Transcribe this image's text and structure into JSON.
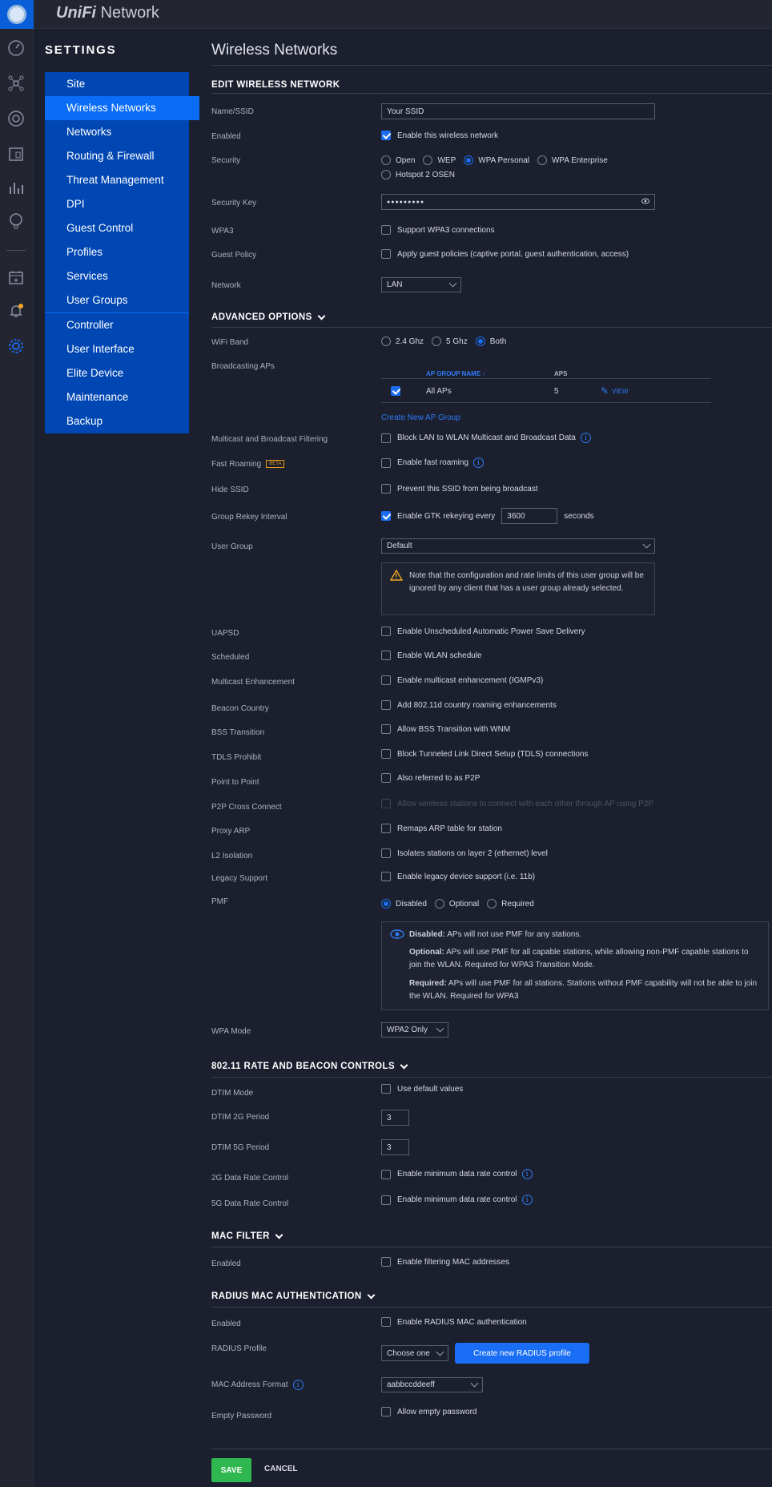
{
  "app": {
    "brand_prefix": "UniFi",
    "brand_suffix": "Network"
  },
  "settings_title": "SETTINGS",
  "nav": {
    "items": [
      "Site",
      "Wireless Networks",
      "Networks",
      "Routing & Firewall",
      "Threat Management",
      "DPI",
      "Guest Control",
      "Profiles",
      "Services",
      "User Groups"
    ],
    "items2": [
      "Controller",
      "User Interface",
      "Elite Device",
      "Maintenance",
      "Backup"
    ]
  },
  "page_title": "Wireless Networks",
  "edit": {
    "heading": "EDIT WIRELESS NETWORK",
    "name_label": "Name/SSID",
    "name_value": "Your SSID",
    "enabled_label": "Enabled",
    "enabled_text": "Enable this wireless network",
    "security_label": "Security",
    "security_options": [
      "Open",
      "WEP",
      "WPA Personal",
      "WPA Enterprise",
      "Hotspot 2 OSEN"
    ],
    "key_label": "Security Key",
    "key_value": "●●●●●●●●●",
    "wpa3_label": "WPA3",
    "wpa3_text": "Support WPA3 connections",
    "guest_label": "Guest Policy",
    "guest_text": "Apply guest policies (captive portal, guest authentication, access)",
    "network_label": "Network",
    "network_value": "LAN"
  },
  "advanced": {
    "heading": "ADVANCED OPTIONS",
    "band_label": "WiFi Band",
    "band_options": [
      "2.4 Ghz",
      "5 Ghz",
      "Both"
    ],
    "aps_label": "Broadcasting APs",
    "ap_table": {
      "col_name": "AP GROUP NAME",
      "col_aps": "APS",
      "row_name": "All APs",
      "row_aps": "5",
      "row_action": "VIEW"
    },
    "create_group": "Create New AP Group",
    "mcast_label": "Multicast and Broadcast Filtering",
    "mcast_text": "Block LAN to WLAN Multicast and Broadcast Data",
    "fast_label": "Fast Roaming",
    "beta": "BETA",
    "fast_text": "Enable fast roaming",
    "hide_label": "Hide SSID",
    "hide_text": "Prevent this SSID from being broadcast",
    "rekey_label": "Group Rekey Interval",
    "rekey_text": "Enable GTK rekeying every",
    "rekey_value": "3600",
    "rekey_unit": "seconds",
    "usergroup_label": "User Group",
    "usergroup_value": "Default",
    "warning": "Note that the configuration and rate limits of this user group will be ignored by any client that has a user group already selected.",
    "uapsd_label": "UAPSD",
    "uapsd_text": "Enable Unscheduled Automatic Power Save Delivery",
    "sched_label": "Scheduled",
    "sched_text": "Enable WLAN schedule",
    "menh_label": "Multicast Enhancement",
    "menh_text": "Enable multicast enhancement (IGMPv3)",
    "beacon_label": "Beacon Country",
    "beacon_text": "Add 802.11d country roaming enhancements",
    "bss_label": "BSS Transition",
    "bss_text": "Allow BSS Transition with WNM",
    "tdls_label": "TDLS Prohibit",
    "tdls_text": "Block Tunneled Link Direct Setup (TDLS) connections",
    "p2p_label": "Point to Point",
    "p2p_text": "Also referred to as P2P",
    "p2pc_label": "P2P Cross Connect",
    "p2pc_text": "Allow wireless stations to connect with each other through AP using P2P",
    "arp_label": "Proxy ARP",
    "arp_text": "Remaps ARP table for station",
    "l2_label": "L2 Isolation",
    "l2_text": "Isolates stations on layer 2 (ethernet) level",
    "legacy_label": "Legacy Support",
    "legacy_text": "Enable legacy device support (i.e. 11b)",
    "pmf_label": "PMF",
    "pmf_options": [
      "Disabled",
      "Optional",
      "Required"
    ],
    "pmf_info": {
      "disabled_b": "Disabled:",
      "disabled_t": "APs will not use PMF for any stations.",
      "optional_b": "Optional:",
      "optional_t": "APs will use PMF for all capable stations, while allowing non-PMF capable stations to join the WLAN. Required for WPA3 Transition Mode.",
      "required_b": "Required:",
      "required_t": "APs will use PMF for all stations. Stations without PMF capability will not be able to join the WLAN. Required for WPA3"
    },
    "wpamode_label": "WPA Mode",
    "wpamode_value": "WPA2 Only"
  },
  "rate": {
    "heading": "802.11 RATE AND BEACON CONTROLS",
    "dtim_label": "DTIM Mode",
    "dtim_text": "Use default values",
    "dtim2_label": "DTIM 2G Period",
    "dtim2_value": "3",
    "dtim5_label": "DTIM 5G Period",
    "dtim5_value": "3",
    "rate2_label": "2G Data Rate Control",
    "rate2_text": "Enable minimum data rate control",
    "rate5_label": "5G Data Rate Control",
    "rate5_text": "Enable minimum data rate control"
  },
  "mac": {
    "heading": "MAC FILTER",
    "enabled_label": "Enabled",
    "enabled_text": "Enable filtering MAC addresses"
  },
  "radius": {
    "heading": "RADIUS MAC AUTHENTICATION",
    "enabled_label": "Enabled",
    "enabled_text": "Enable RADIUS MAC authentication",
    "profile_label": "RADIUS Profile",
    "profile_value": "Choose one",
    "create_btn": "Create new RADIUS profile",
    "format_label": "MAC Address Format",
    "format_value": "aabbccddeeff",
    "empty_label": "Empty Password",
    "empty_text": "Allow empty password"
  },
  "actions": {
    "save": "SAVE",
    "cancel": "CANCEL"
  }
}
